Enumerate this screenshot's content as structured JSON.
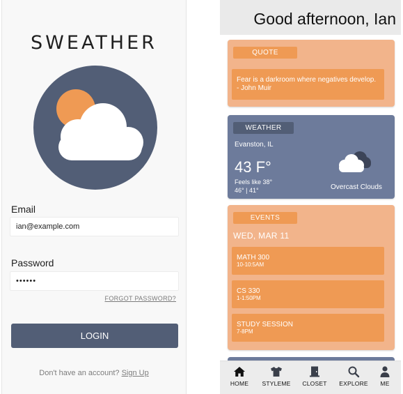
{
  "login": {
    "brand": "SWEATHER",
    "email_label": "Email",
    "email_value": "ian@example.com",
    "password_label": "Password",
    "password_value": "••••••",
    "forgot_label": "FORGOT PASSWORD?",
    "login_label": "LOGIN",
    "signup_prompt": "Don't have an account? ",
    "signup_link": "Sign Up"
  },
  "home": {
    "greeting": "Good afternoon, Ian",
    "quote": {
      "tag": "QUOTE",
      "text": "Fear is a darkroom where negatives develop. - John Muir"
    },
    "weather": {
      "tag": "WEATHER",
      "location": "Evanston, IL",
      "temperature": "43 F°",
      "feels_like": "Feels like 38°",
      "range": "46° | 41°",
      "condition": "Overcast Clouds",
      "icon": "cloud-icon"
    },
    "events": {
      "tag": "EVENTS",
      "date": "WED, MAR 11",
      "items": [
        {
          "title": "MATH 300",
          "time": "10-10:5AM"
        },
        {
          "title": "CS 330",
          "time": "1-1:50PM"
        },
        {
          "title": "STUDY SESSION",
          "time": "7-8PM"
        }
      ]
    },
    "nav": [
      {
        "label": "HOME",
        "icon": "home-icon"
      },
      {
        "label": "STYLEME",
        "icon": "shirt-icon"
      },
      {
        "label": "CLOSET",
        "icon": "closet-icon"
      },
      {
        "label": "EXPLORE",
        "icon": "search-icon"
      },
      {
        "label": "ME",
        "icon": "person-icon"
      }
    ]
  },
  "colors": {
    "slate": "#525e76",
    "weather_card": "#6d7b9b",
    "card_orange_light": "#f2b48b",
    "card_orange": "#ef9a54"
  }
}
